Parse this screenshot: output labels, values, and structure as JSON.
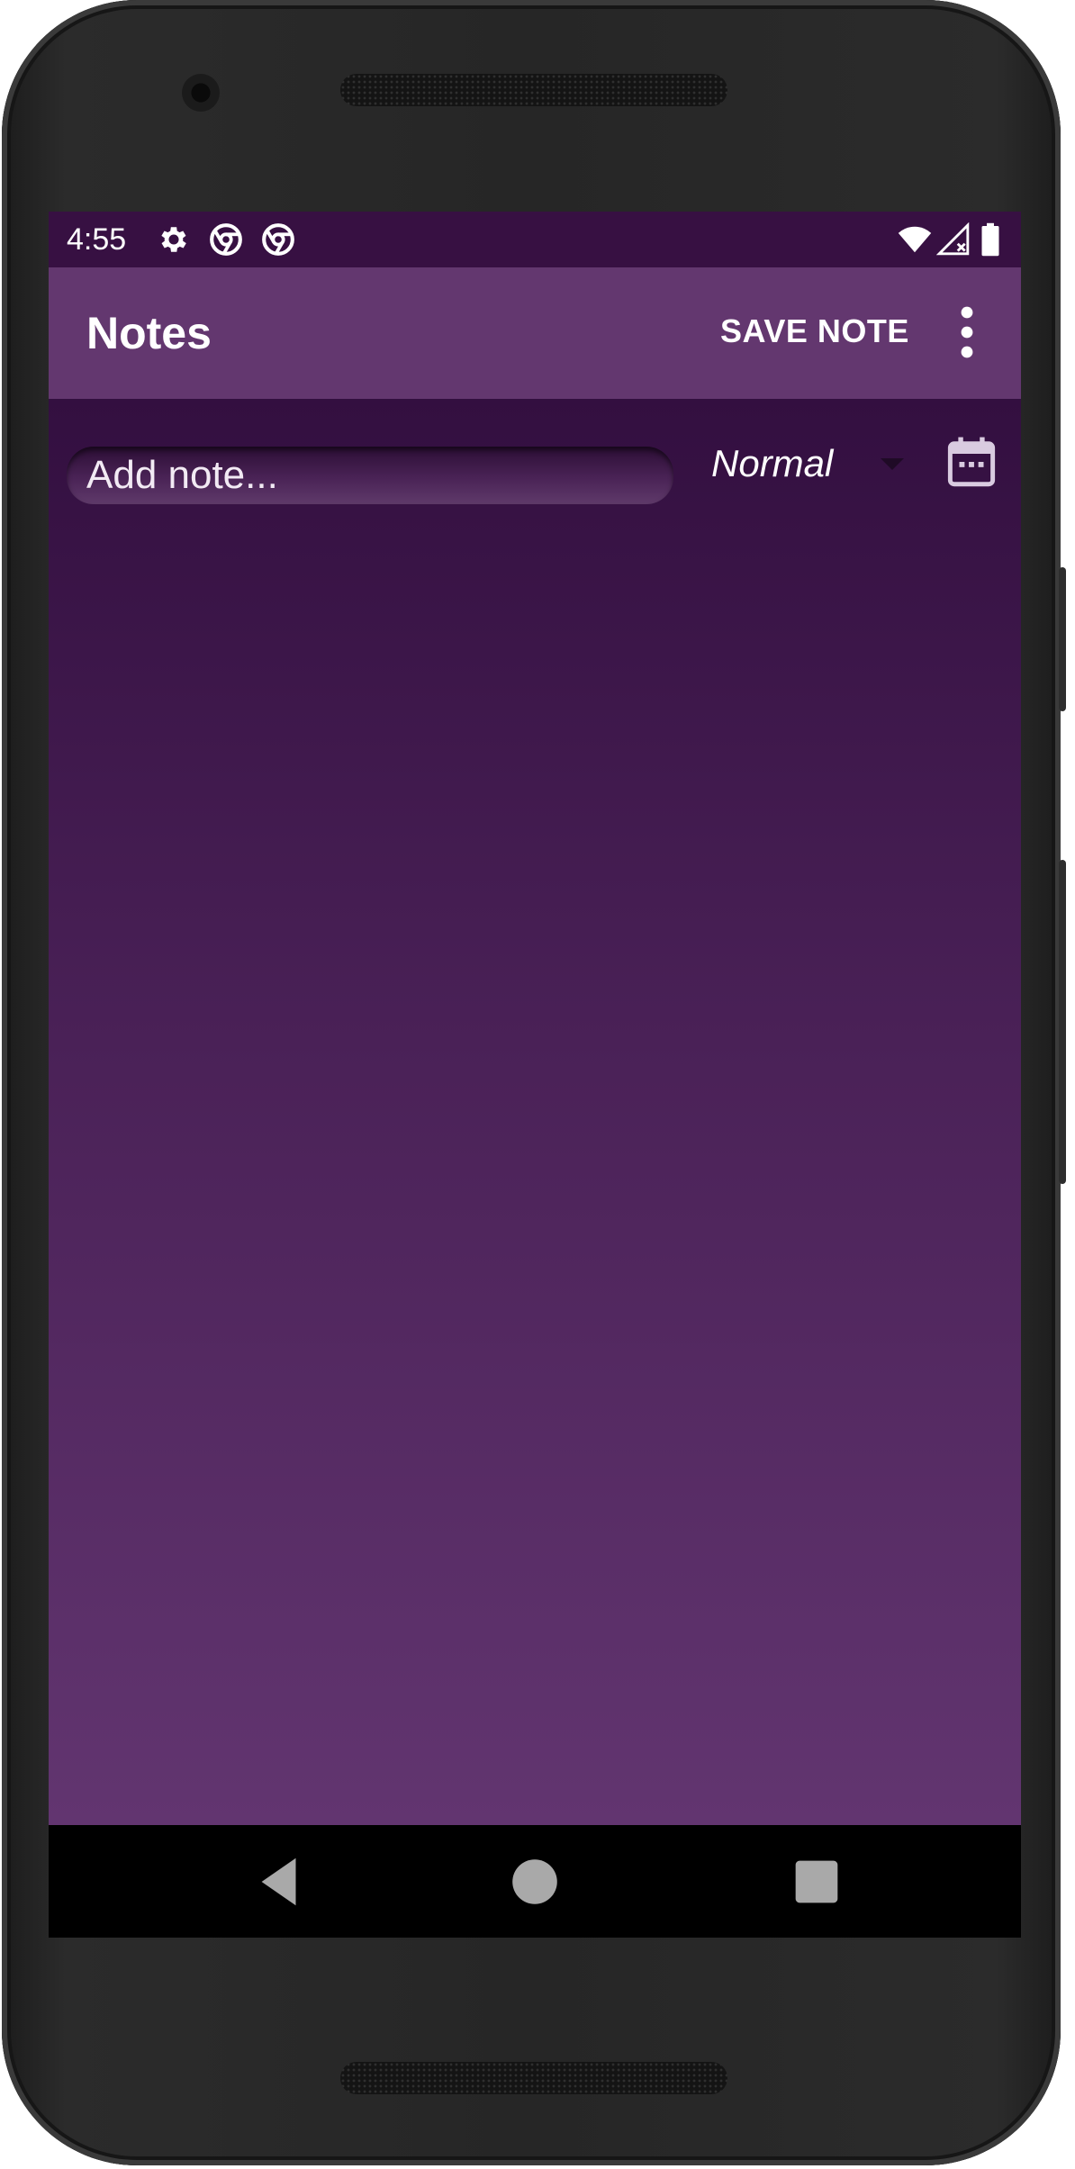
{
  "status_bar": {
    "time": "4:55",
    "left_icons": [
      "settings-icon",
      "chrome-icon",
      "chrome-icon"
    ],
    "right_icons": [
      "wifi-icon",
      "cell-signal-no-service-icon",
      "battery-icon"
    ]
  },
  "app_bar": {
    "title": "Notes",
    "save_label": "SAVE NOTE",
    "overflow_icon": "more-vert-icon"
  },
  "editor": {
    "note_placeholder": "Add note...",
    "note_value": "",
    "priority_selected": "Normal",
    "calendar_icon": "calendar-icon"
  },
  "nav_bar": {
    "buttons": [
      "back-icon",
      "home-icon",
      "recents-icon"
    ]
  },
  "colors": {
    "status_bar": "#371042",
    "app_bar": "#63376f",
    "content_top": "#330f40",
    "content_bottom": "#623570",
    "nav_bar": "#000000"
  }
}
